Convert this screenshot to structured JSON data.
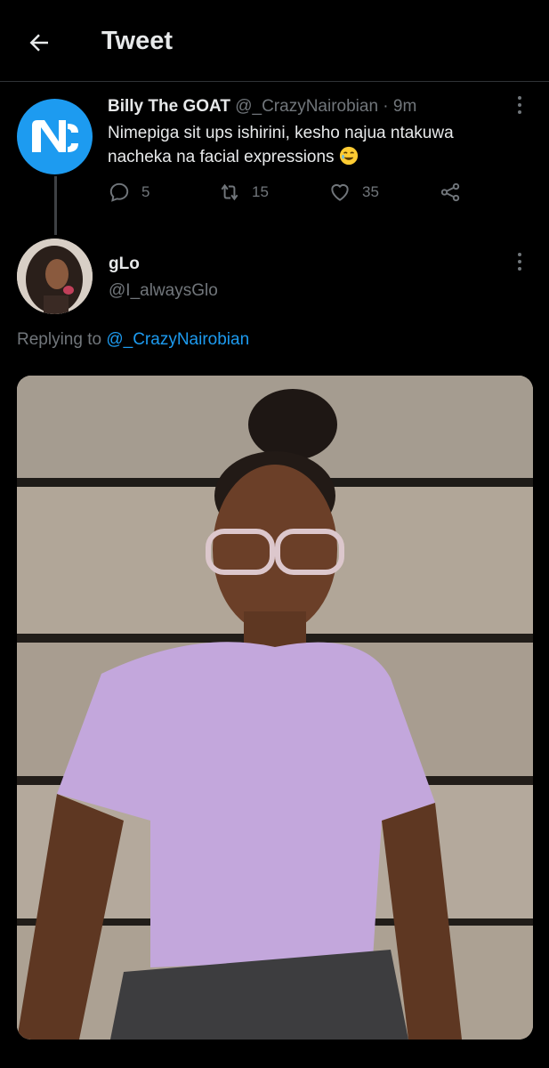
{
  "header": {
    "title": "Tweet",
    "back_icon": "arrow-left-icon"
  },
  "original_tweet": {
    "display_name": "Billy The GOAT",
    "handle": "@_CrazyNairobian",
    "time": "· 9m",
    "text": "Nimepiga sit ups ishirini, kesho najua ntakuwa nacheka na facial expressions",
    "emoji": "face-with-tears-emoji",
    "avatar_logo": "N",
    "replies": "5",
    "retweets": "15",
    "likes": "35"
  },
  "reply": {
    "display_name": "gLo",
    "handle": "@I_alwaysGlo",
    "replying_prefix": "Replying to",
    "replying_to": "@_CrazyNairobian"
  },
  "colors": {
    "background": "#000000",
    "text_primary": "#e7e9ea",
    "text_secondary": "#71767b",
    "accent": "#1d9bf0",
    "divider": "#2f3336"
  }
}
